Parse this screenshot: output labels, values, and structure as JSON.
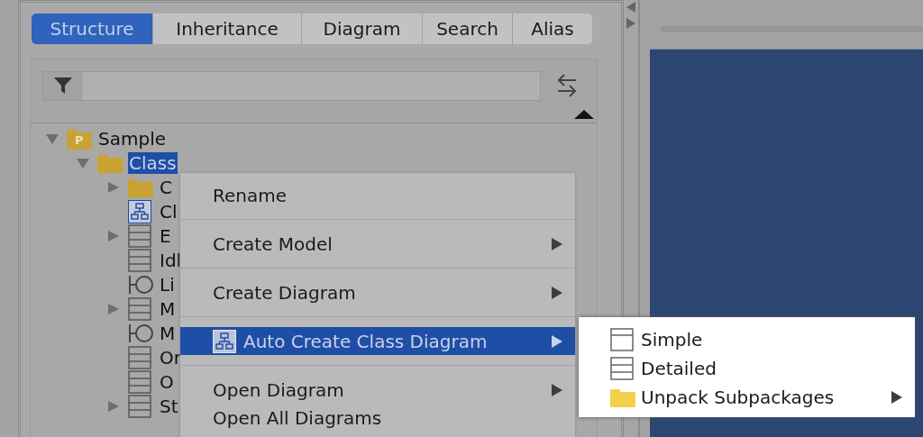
{
  "tabs": [
    {
      "label": "Structure",
      "selected": true
    },
    {
      "label": "Inheritance",
      "selected": false
    },
    {
      "label": "Diagram",
      "selected": false
    },
    {
      "label": "Search",
      "selected": false
    },
    {
      "label": "Alias",
      "selected": false
    }
  ],
  "tree": [
    {
      "label": "Sample",
      "kind": "package",
      "icon_letter": "P",
      "expanded": true,
      "selected": false,
      "children": [
        {
          "label": "Class",
          "kind": "folder",
          "expanded": true,
          "selected": true,
          "children": [
            {
              "label": "C",
              "kind": "folder",
              "expanded": false,
              "selected": false
            },
            {
              "label": "Cl",
              "kind": "diagram",
              "selected": false
            },
            {
              "label": "E",
              "kind": "class",
              "expanded": false,
              "selected": false
            },
            {
              "label": "Idl",
              "kind": "class",
              "selected": false
            },
            {
              "label": "Li",
              "kind": "interface",
              "selected": false
            },
            {
              "label": "M",
              "kind": "class",
              "expanded": false,
              "selected": false
            },
            {
              "label": "M",
              "kind": "interface",
              "selected": false
            },
            {
              "label": "Or",
              "kind": "class",
              "selected": false
            },
            {
              "label": "O",
              "kind": "class",
              "selected": false
            },
            {
              "label": "St",
              "kind": "class",
              "expanded": false,
              "selected": false
            }
          ]
        }
      ]
    }
  ],
  "context_menu": {
    "items": [
      {
        "kind": "plain",
        "label": "Rename",
        "selected": false,
        "submenu": false
      },
      {
        "kind": "separator"
      },
      {
        "kind": "plain",
        "label": "Create Model",
        "selected": false,
        "submenu": true
      },
      {
        "kind": "separator"
      },
      {
        "kind": "plain",
        "label": "Create Diagram",
        "selected": false,
        "submenu": true
      },
      {
        "kind": "separator"
      },
      {
        "kind": "diagram",
        "label": "Auto Create Class Diagram",
        "selected": true,
        "submenu": true
      },
      {
        "kind": "separator"
      },
      {
        "kind": "plain",
        "label": "Open Diagram",
        "selected": false,
        "submenu": true
      },
      {
        "kind": "plain",
        "label": "Open All Diagrams",
        "selected": false,
        "submenu": false
      }
    ]
  },
  "submenu": {
    "items": [
      {
        "kind": "class-simple",
        "label": "Simple",
        "selected": false,
        "submenu": false
      },
      {
        "kind": "class",
        "label": "Detailed",
        "selected": false,
        "submenu": false
      },
      {
        "kind": "folder",
        "label": "Unpack Subpackages",
        "selected": false,
        "submenu": true
      }
    ]
  }
}
